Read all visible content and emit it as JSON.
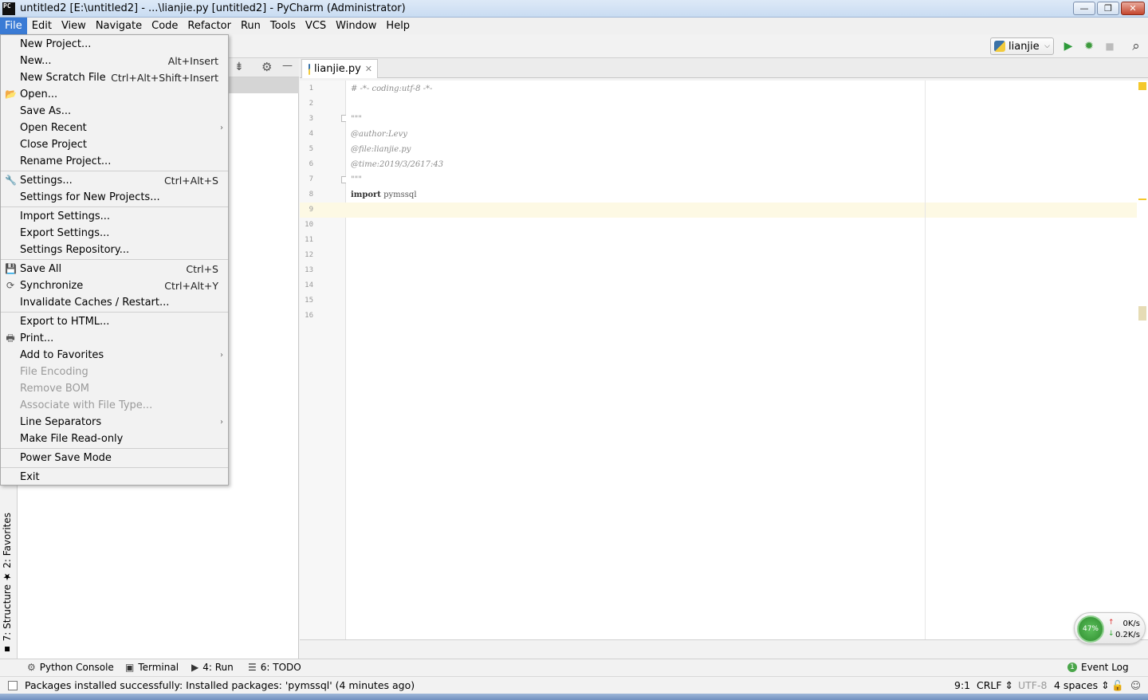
{
  "window": {
    "title": "untitled2 [E:\\untitled2] - ...\\lianjie.py [untitled2] - PyCharm (Administrator)",
    "app_icon_text": "PC",
    "minimize": "—",
    "restore": "❐",
    "close": "✕"
  },
  "menubar": [
    "File",
    "Edit",
    "View",
    "Navigate",
    "Code",
    "Refactor",
    "Run",
    "Tools",
    "VCS",
    "Window",
    "Help"
  ],
  "toolbar": {
    "run_config": "lianjie",
    "chevron": "⌵",
    "run_icon": "▶",
    "debug_icon": "✹",
    "stop_icon": "■",
    "search_icon": "⌕"
  },
  "project_panel": {
    "collapse_icon": "⇟",
    "gear_icon": "⚙",
    "hide_icon": "—"
  },
  "side_tabs": {
    "favorites": "2: Favorites",
    "structure": "7: Structure"
  },
  "editor": {
    "tab_label": "lianjie.py",
    "tab_close": "✕",
    "line_numbers": [
      "1",
      "2",
      "3",
      "4",
      "5",
      "6",
      "7",
      "8",
      "9",
      "10",
      "11",
      "12",
      "13",
      "14",
      "15",
      "16"
    ],
    "lines": [
      "# -*- coding:utf-8 -*-",
      "",
      "\"\"\"",
      "@author:Levy",
      "@file:lianjie.py",
      "@time:2019/3/2617:43",
      "\"\"\"",
      "import pymssql"
    ],
    "import_keyword": "import",
    "import_module": " pymssql"
  },
  "file_menu": {
    "items": [
      {
        "label": "New Project...",
        "shortcut": "",
        "icon": "",
        "submenu": false,
        "disabled": false
      },
      {
        "label": "New...",
        "shortcut": "Alt+Insert",
        "icon": "",
        "submenu": false,
        "disabled": false
      },
      {
        "label": "New Scratch File",
        "shortcut": "Ctrl+Alt+Shift+Insert",
        "icon": "",
        "submenu": false,
        "disabled": false
      },
      {
        "label": "Open...",
        "shortcut": "",
        "icon": "📂",
        "submenu": false,
        "disabled": false
      },
      {
        "label": "Save As...",
        "shortcut": "",
        "icon": "",
        "submenu": false,
        "disabled": false
      },
      {
        "label": "Open Recent",
        "shortcut": "",
        "icon": "",
        "submenu": true,
        "disabled": false
      },
      {
        "label": "Close Project",
        "shortcut": "",
        "icon": "",
        "submenu": false,
        "disabled": false
      },
      {
        "label": "Rename Project...",
        "shortcut": "",
        "icon": "",
        "submenu": false,
        "disabled": false
      },
      {
        "label": "Settings...",
        "shortcut": "Ctrl+Alt+S",
        "icon": "🔧",
        "submenu": false,
        "disabled": false
      },
      {
        "label": "Settings for New Projects...",
        "shortcut": "",
        "icon": "",
        "submenu": false,
        "disabled": false
      },
      {
        "label": "Import Settings...",
        "shortcut": "",
        "icon": "",
        "submenu": false,
        "disabled": false
      },
      {
        "label": "Export Settings...",
        "shortcut": "",
        "icon": "",
        "submenu": false,
        "disabled": false
      },
      {
        "label": "Settings Repository...",
        "shortcut": "",
        "icon": "",
        "submenu": false,
        "disabled": false
      },
      {
        "label": "Save All",
        "shortcut": "Ctrl+S",
        "icon": "💾",
        "submenu": false,
        "disabled": false
      },
      {
        "label": "Synchronize",
        "shortcut": "Ctrl+Alt+Y",
        "icon": "⟳",
        "submenu": false,
        "disabled": false
      },
      {
        "label": "Invalidate Caches / Restart...",
        "shortcut": "",
        "icon": "",
        "submenu": false,
        "disabled": false
      },
      {
        "label": "Export to HTML...",
        "shortcut": "",
        "icon": "",
        "submenu": false,
        "disabled": false
      },
      {
        "label": "Print...",
        "shortcut": "",
        "icon": "🖶",
        "submenu": false,
        "disabled": false
      },
      {
        "label": "Add to Favorites",
        "shortcut": "",
        "icon": "",
        "submenu": true,
        "disabled": false
      },
      {
        "label": "File Encoding",
        "shortcut": "",
        "icon": "",
        "submenu": false,
        "disabled": true
      },
      {
        "label": "Remove BOM",
        "shortcut": "",
        "icon": "",
        "submenu": false,
        "disabled": true
      },
      {
        "label": "Associate with File Type...",
        "shortcut": "",
        "icon": "",
        "submenu": false,
        "disabled": true
      },
      {
        "label": "Line Separators",
        "shortcut": "",
        "icon": "",
        "submenu": true,
        "disabled": false
      },
      {
        "label": "Make File Read-only",
        "shortcut": "",
        "icon": "",
        "submenu": false,
        "disabled": false
      },
      {
        "label": "Power Save Mode",
        "shortcut": "",
        "icon": "",
        "submenu": false,
        "disabled": false
      },
      {
        "label": "Exit",
        "shortcut": "",
        "icon": "",
        "submenu": false,
        "disabled": false
      }
    ],
    "submenu_arrow": "›"
  },
  "network_widget": {
    "percent": "47%",
    "up_arrow": "↑",
    "down_arrow": "↓",
    "upload": "0K/s",
    "download": "0.2K/s"
  },
  "tool_tabs": {
    "python_console": "Python Console",
    "terminal": "Terminal",
    "run": "4: Run",
    "todo": "6: TODO",
    "event_log": "Event Log",
    "event_log_badge": "1"
  },
  "status": {
    "message": "Packages installed successfully: Installed packages: 'pymssql' (4 minutes ago)",
    "position": "9:1",
    "line_sep": "CRLF ⇕",
    "encoding": "UTF-8",
    "indent": "4 spaces ⇕"
  }
}
